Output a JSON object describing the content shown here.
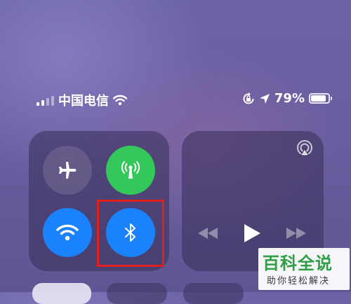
{
  "status_bar": {
    "carrier": "中国电信",
    "battery_percent": "79%",
    "battery_level": 0.79,
    "signal_bars_filled": 2,
    "icons": [
      "signal-icon",
      "wifi-icon",
      "rotation-lock-icon",
      "location-icon",
      "battery-icon"
    ]
  },
  "connectivity": {
    "airplane_mode": {
      "icon": "airplane-icon",
      "active": false
    },
    "cellular_data": {
      "icon": "antenna-icon",
      "active": true,
      "color": "#34c759"
    },
    "wifi": {
      "icon": "wifi-icon",
      "active": true,
      "color": "#1a82fb"
    },
    "bluetooth": {
      "icon": "bluetooth-icon",
      "active": true,
      "color": "#1a82fb"
    },
    "highlight_color": "#e0201f"
  },
  "media": {
    "icons": [
      "airplay-icon",
      "rewind-icon",
      "play-icon",
      "fast-forward-icon"
    ]
  },
  "watermark": {
    "title": "百科全说",
    "subtitle": "助你轻松解决",
    "color": "#2f9e46"
  }
}
